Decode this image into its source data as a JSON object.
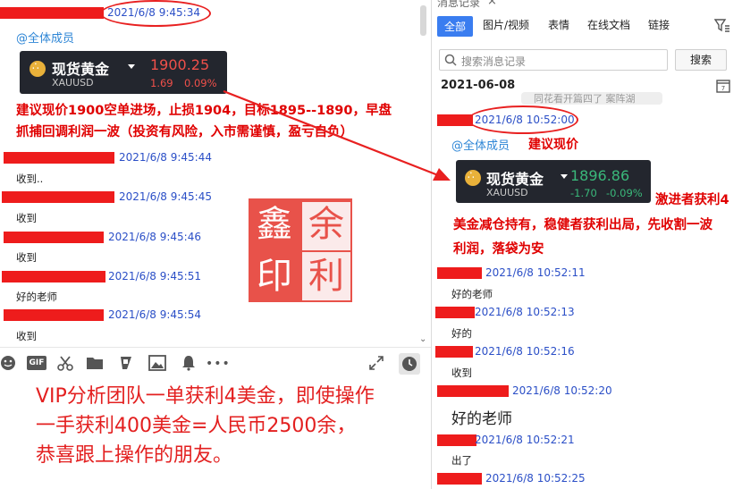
{
  "left": {
    "messages": [
      {
        "time": "2021/6/8 9:45:34"
      },
      {
        "time": "2021/6/8 9:45:44",
        "text": "收到.."
      },
      {
        "time": "2021/6/8 9:45:45",
        "text": "收到"
      },
      {
        "time": "2021/6/8 9:45:46",
        "text": "收到"
      },
      {
        "time": "2021/6/8 9:45:51",
        "text": "好的老师"
      },
      {
        "time": "2021/6/8 9:45:54",
        "text": "收到"
      }
    ],
    "mention": "@全体成员",
    "gold": {
      "name": "现货黄金",
      "code": "XAUUSD",
      "price": "1900.25",
      "change": "1.69",
      "percent": "0.09%",
      "color": "#f0504a"
    },
    "advice_line1": "建议现价1900空单进场，止损1904，目标1895--1890，早盘",
    "advice_line2": "抓捕回调利润一波（投资有风险，入市需谨慎，盈亏自负）",
    "toolbar_icons": [
      "emoji-icon",
      "gif-icon",
      "scissors-icon",
      "folder-icon",
      "shake-icon",
      "image-icon",
      "bell-icon",
      "more-icon",
      "expand-icon",
      "history-icon"
    ],
    "gif_label": "GIF",
    "caption_line1": "VIP分析团队一单获利4美金，即使操作",
    "caption_line2": "一手获利400美金=人民币2500余，",
    "caption_line3": "恭喜跟上操作的朋友。"
  },
  "seal": {
    "chars": [
      "鑫",
      "余",
      "印",
      "利"
    ]
  },
  "right": {
    "window_title": "消息记录",
    "tabs": [
      "全部",
      "图片/视频",
      "表情",
      "在线文档",
      "链接"
    ],
    "search_placeholder": "搜索消息记录",
    "search_button": "搜索",
    "date": "2021-06-08",
    "prev_bubble": "同花看开篇四了  案阵湖",
    "first_time": "2021/6/8 10:52:00",
    "mention": "@全体成员",
    "mention_text": "建议现价",
    "gold": {
      "name": "现货黄金",
      "code": "XAUUSD",
      "price": "1896.86",
      "change": "-1.70",
      "percent": "-0.09%",
      "color": "#3ab87a"
    },
    "note_line1": "激进者获利4",
    "note_line2": "美金减仓持有，稳健者获利出局，先收割一波",
    "note_line3": "利润，落袋为安",
    "messages": [
      {
        "time": "2021/6/8 10:52:11",
        "text": "好的老师"
      },
      {
        "time": "2021/6/8 10:52:13",
        "text": "好的"
      },
      {
        "time": "2021/6/8 10:52:16",
        "text": "收到"
      },
      {
        "time": "2021/6/8 10:52:20",
        "text": "好的老师"
      },
      {
        "time": "2021/6/8 10:52:21",
        "text": "出了"
      },
      {
        "time": "2021/6/8 10:52:25"
      }
    ]
  }
}
